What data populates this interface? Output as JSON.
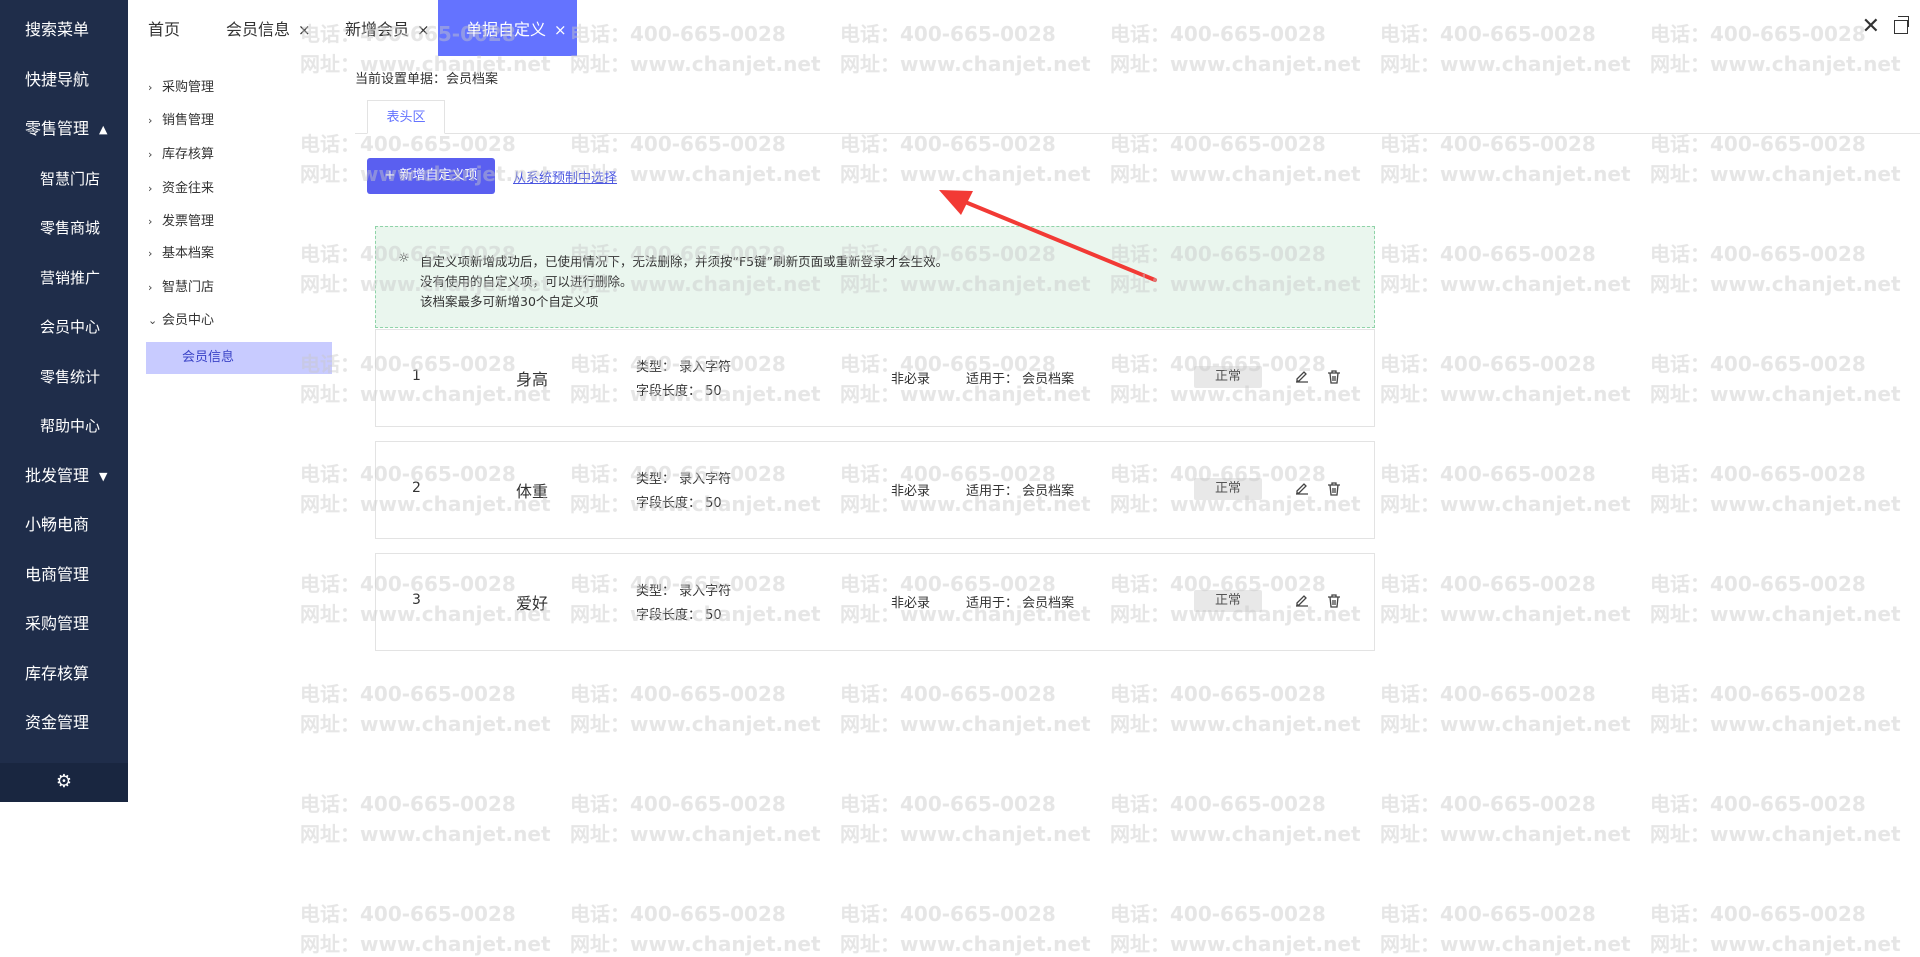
{
  "sidebar": {
    "items": [
      {
        "label": "搜索菜单"
      },
      {
        "label": "快捷导航"
      },
      {
        "label": "零售管理",
        "caret": "▲"
      },
      {
        "label": "智慧门店"
      },
      {
        "label": "零售商城"
      },
      {
        "label": "营销推广"
      },
      {
        "label": "会员中心"
      },
      {
        "label": "零售统计"
      },
      {
        "label": "帮助中心"
      },
      {
        "label": "批发管理",
        "caret": "▼"
      },
      {
        "label": "小畅电商"
      },
      {
        "label": "电商管理"
      },
      {
        "label": "采购管理"
      },
      {
        "label": "库存核算"
      },
      {
        "label": "资金管理"
      }
    ],
    "gear_glyph": "⚙"
  },
  "tabs": [
    {
      "label": "首页"
    },
    {
      "label": "会员信息",
      "close": "×"
    },
    {
      "label": "新增会员",
      "close": "×"
    },
    {
      "label": "单据自定义",
      "close": "×"
    }
  ],
  "window": {
    "close": "✕"
  },
  "tree": {
    "nodes": [
      {
        "label": "采购管理",
        "chev": "›"
      },
      {
        "label": "销售管理",
        "chev": "›"
      },
      {
        "label": "库存核算",
        "chev": "›"
      },
      {
        "label": "资金往来",
        "chev": "›"
      },
      {
        "label": "发票管理",
        "chev": "›"
      },
      {
        "label": "基本档案",
        "chev": "›"
      },
      {
        "label": "智慧门店",
        "chev": "›"
      },
      {
        "label": "会员中心",
        "chev": "⌄"
      }
    ],
    "leaf": "会员信息"
  },
  "main": {
    "current_setting": "当前设置单据：会员档案",
    "subtab": "表头区",
    "add_button": "+ 新增自定义项",
    "preset_link": "从系统预制中选择",
    "notice": {
      "bulb": "☼",
      "lines": [
        "自定义项新增成功后，已使用情况下，无法删除，并须按“F5键”刷新页面或重新登录才会生效。",
        "没有使用的自定义项，可以进行删除。",
        "该档案最多可新增30个自定义项"
      ]
    },
    "rows": [
      {
        "num": "1",
        "name": "身高",
        "type": "类型：  录入字符",
        "length": "字段长度：  50",
        "required": "非必录",
        "apply": "适用于：  会员档案",
        "status": "正常"
      },
      {
        "num": "2",
        "name": "体重",
        "type": "类型：  录入字符",
        "length": "字段长度：  50",
        "required": "非必录",
        "apply": "适用于：  会员档案",
        "status": "正常"
      },
      {
        "num": "3",
        "name": "爱好",
        "type": "类型：  录入字符",
        "length": "字段长度：  50",
        "required": "非必录",
        "apply": "适用于：  会员档案",
        "status": "正常"
      }
    ]
  },
  "watermark": {
    "phone": "电话：400-665-0028",
    "site": "网址：www.chanjet.net"
  },
  "colors": {
    "sidebar": "#1f2d4a",
    "accent": "#6473ff",
    "arrow": "#f23a35",
    "notice_bg": "#eaf6ee"
  }
}
